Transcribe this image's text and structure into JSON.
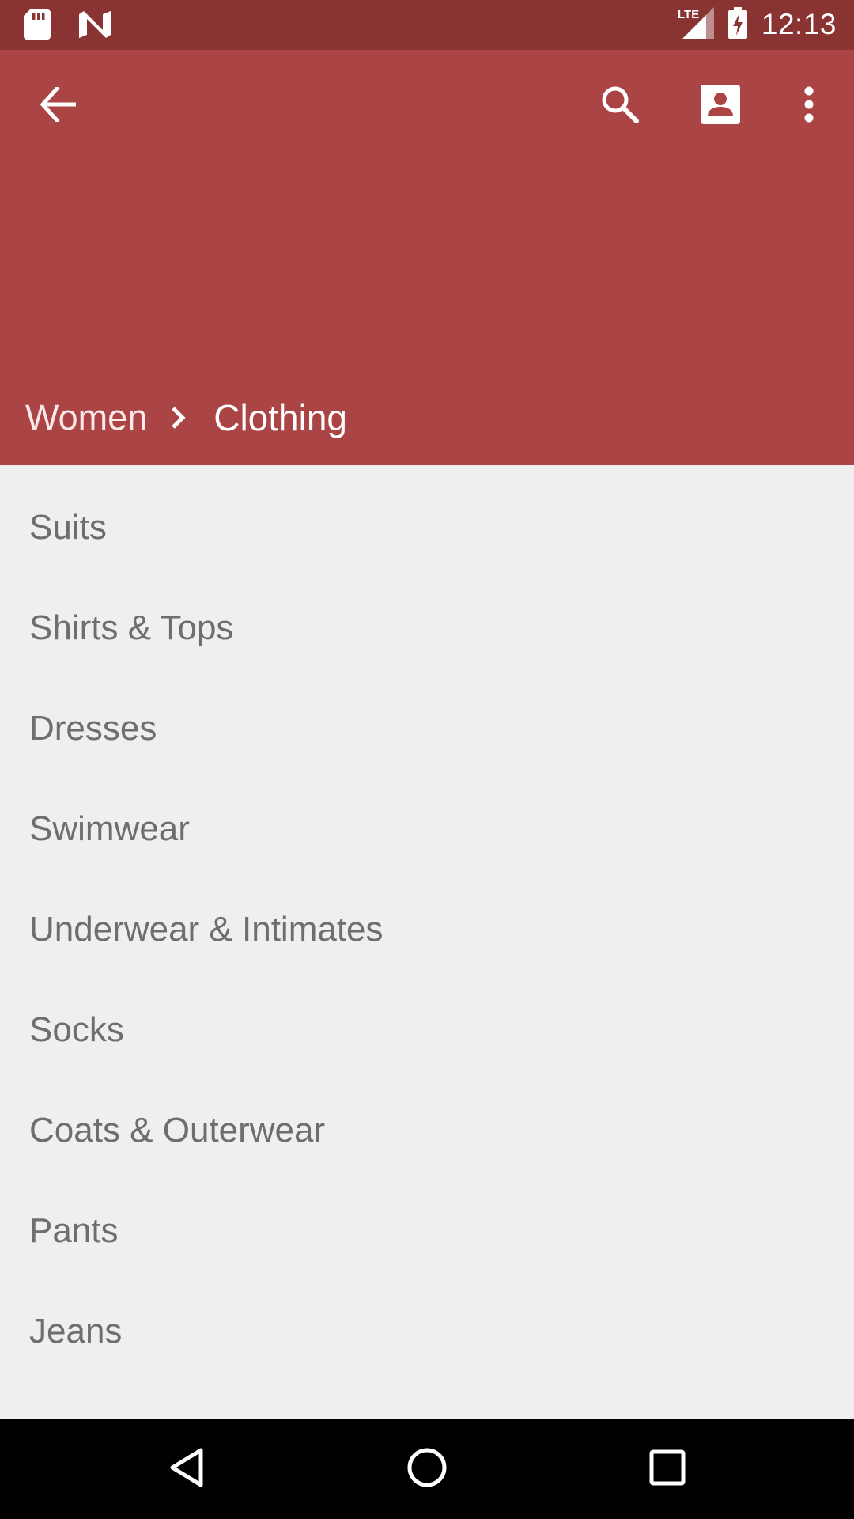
{
  "status_bar": {
    "time": "12:13",
    "network_label": "LTE",
    "icons": [
      "sd-card-icon",
      "n-notification-icon",
      "lte-signal-icon",
      "battery-charging-icon"
    ]
  },
  "app_bar": {
    "color": "#ab4444",
    "icons": [
      "back-arrow-icon",
      "search-icon",
      "account-icon",
      "more-vert-icon"
    ]
  },
  "breadcrumb": {
    "parent": "Women",
    "current": "Clothing"
  },
  "categories": [
    "Suits",
    "Shirts & Tops",
    "Dresses",
    "Swimwear",
    "Underwear & Intimates",
    "Socks",
    "Coats & Outerwear",
    "Pants",
    "Jeans",
    "Sweaters"
  ],
  "nav_bar": {
    "icons": [
      "nav-back-icon",
      "nav-home-icon",
      "nav-recents-icon"
    ]
  }
}
